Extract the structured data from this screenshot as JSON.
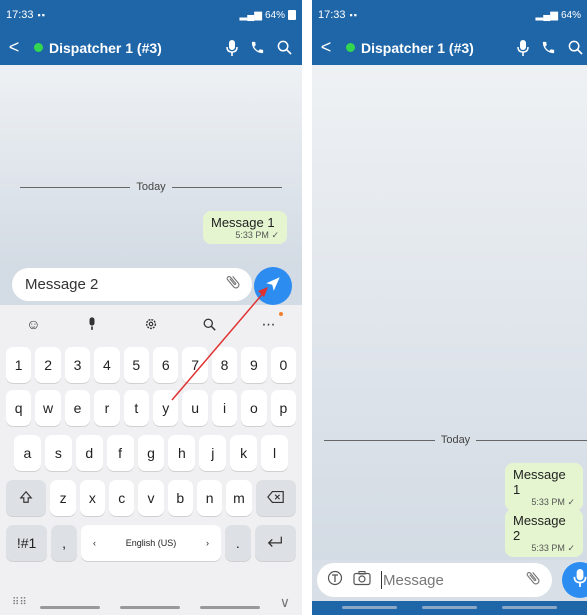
{
  "colors": {
    "primary": "#1f66a8",
    "online": "#33d64f",
    "bubble": "#e5f5cf",
    "send": "#2d8cf0",
    "annotation_arrow": "#e03030"
  },
  "left": {
    "status_bar": {
      "time": "17:33",
      "battery": "64%"
    },
    "app_bar": {
      "back": "<",
      "title": "Dispatcher 1 (#3)"
    },
    "divider": "Today",
    "messages": [
      {
        "text": "Message 1",
        "time": "5:33 PM",
        "check": "✓"
      }
    ],
    "input_value": "Message 2",
    "keyboard": {
      "toolbar": [
        "☺",
        "mic-icon",
        "gear-icon",
        "search-icon",
        "⋯"
      ],
      "numbers": [
        "1",
        "2",
        "3",
        "4",
        "5",
        "6",
        "7",
        "8",
        "9",
        "0"
      ],
      "row1": [
        "q",
        "w",
        "e",
        "r",
        "t",
        "y",
        "u",
        "i",
        "o",
        "p"
      ],
      "row2": [
        "a",
        "s",
        "d",
        "f",
        "g",
        "h",
        "j",
        "k",
        "l"
      ],
      "row3": [
        "z",
        "x",
        "c",
        "v",
        "b",
        "n",
        "m"
      ],
      "symbols_key": "!#1",
      "comma": ",",
      "space_label": "English (US)",
      "space_left": "‹",
      "space_right": "›",
      "period": ".",
      "grid_label": "⠿⠿",
      "collapse": "∨"
    }
  },
  "right": {
    "status_bar": {
      "time": "17:33",
      "battery": "64%"
    },
    "app_bar": {
      "back": "<",
      "title": "Dispatcher 1 (#3)"
    },
    "divider": "Today",
    "messages": [
      {
        "text": "Message 1",
        "time": "5:33 PM",
        "check": "✓"
      },
      {
        "text": "Message 2",
        "time": "5:33 PM",
        "check": "✓"
      }
    ],
    "input_placeholder": "Message"
  }
}
